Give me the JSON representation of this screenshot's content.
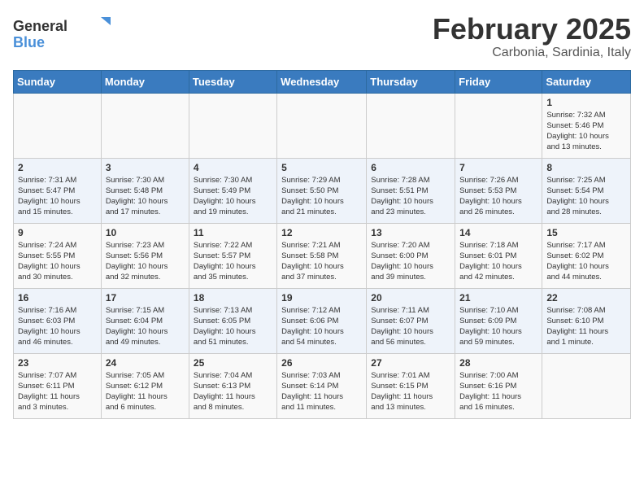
{
  "logo": {
    "general": "General",
    "blue": "Blue"
  },
  "title": "February 2025",
  "subtitle": "Carbonia, Sardinia, Italy",
  "headers": [
    "Sunday",
    "Monday",
    "Tuesday",
    "Wednesday",
    "Thursday",
    "Friday",
    "Saturday"
  ],
  "weeks": [
    [
      {
        "day": "",
        "info": ""
      },
      {
        "day": "",
        "info": ""
      },
      {
        "day": "",
        "info": ""
      },
      {
        "day": "",
        "info": ""
      },
      {
        "day": "",
        "info": ""
      },
      {
        "day": "",
        "info": ""
      },
      {
        "day": "1",
        "info": "Sunrise: 7:32 AM\nSunset: 5:46 PM\nDaylight: 10 hours\nand 13 minutes."
      }
    ],
    [
      {
        "day": "2",
        "info": "Sunrise: 7:31 AM\nSunset: 5:47 PM\nDaylight: 10 hours\nand 15 minutes."
      },
      {
        "day": "3",
        "info": "Sunrise: 7:30 AM\nSunset: 5:48 PM\nDaylight: 10 hours\nand 17 minutes."
      },
      {
        "day": "4",
        "info": "Sunrise: 7:30 AM\nSunset: 5:49 PM\nDaylight: 10 hours\nand 19 minutes."
      },
      {
        "day": "5",
        "info": "Sunrise: 7:29 AM\nSunset: 5:50 PM\nDaylight: 10 hours\nand 21 minutes."
      },
      {
        "day": "6",
        "info": "Sunrise: 7:28 AM\nSunset: 5:51 PM\nDaylight: 10 hours\nand 23 minutes."
      },
      {
        "day": "7",
        "info": "Sunrise: 7:26 AM\nSunset: 5:53 PM\nDaylight: 10 hours\nand 26 minutes."
      },
      {
        "day": "8",
        "info": "Sunrise: 7:25 AM\nSunset: 5:54 PM\nDaylight: 10 hours\nand 28 minutes."
      }
    ],
    [
      {
        "day": "9",
        "info": "Sunrise: 7:24 AM\nSunset: 5:55 PM\nDaylight: 10 hours\nand 30 minutes."
      },
      {
        "day": "10",
        "info": "Sunrise: 7:23 AM\nSunset: 5:56 PM\nDaylight: 10 hours\nand 32 minutes."
      },
      {
        "day": "11",
        "info": "Sunrise: 7:22 AM\nSunset: 5:57 PM\nDaylight: 10 hours\nand 35 minutes."
      },
      {
        "day": "12",
        "info": "Sunrise: 7:21 AM\nSunset: 5:58 PM\nDaylight: 10 hours\nand 37 minutes."
      },
      {
        "day": "13",
        "info": "Sunrise: 7:20 AM\nSunset: 6:00 PM\nDaylight: 10 hours\nand 39 minutes."
      },
      {
        "day": "14",
        "info": "Sunrise: 7:18 AM\nSunset: 6:01 PM\nDaylight: 10 hours\nand 42 minutes."
      },
      {
        "day": "15",
        "info": "Sunrise: 7:17 AM\nSunset: 6:02 PM\nDaylight: 10 hours\nand 44 minutes."
      }
    ],
    [
      {
        "day": "16",
        "info": "Sunrise: 7:16 AM\nSunset: 6:03 PM\nDaylight: 10 hours\nand 46 minutes."
      },
      {
        "day": "17",
        "info": "Sunrise: 7:15 AM\nSunset: 6:04 PM\nDaylight: 10 hours\nand 49 minutes."
      },
      {
        "day": "18",
        "info": "Sunrise: 7:13 AM\nSunset: 6:05 PM\nDaylight: 10 hours\nand 51 minutes."
      },
      {
        "day": "19",
        "info": "Sunrise: 7:12 AM\nSunset: 6:06 PM\nDaylight: 10 hours\nand 54 minutes."
      },
      {
        "day": "20",
        "info": "Sunrise: 7:11 AM\nSunset: 6:07 PM\nDaylight: 10 hours\nand 56 minutes."
      },
      {
        "day": "21",
        "info": "Sunrise: 7:10 AM\nSunset: 6:09 PM\nDaylight: 10 hours\nand 59 minutes."
      },
      {
        "day": "22",
        "info": "Sunrise: 7:08 AM\nSunset: 6:10 PM\nDaylight: 11 hours\nand 1 minute."
      }
    ],
    [
      {
        "day": "23",
        "info": "Sunrise: 7:07 AM\nSunset: 6:11 PM\nDaylight: 11 hours\nand 3 minutes."
      },
      {
        "day": "24",
        "info": "Sunrise: 7:05 AM\nSunset: 6:12 PM\nDaylight: 11 hours\nand 6 minutes."
      },
      {
        "day": "25",
        "info": "Sunrise: 7:04 AM\nSunset: 6:13 PM\nDaylight: 11 hours\nand 8 minutes."
      },
      {
        "day": "26",
        "info": "Sunrise: 7:03 AM\nSunset: 6:14 PM\nDaylight: 11 hours\nand 11 minutes."
      },
      {
        "day": "27",
        "info": "Sunrise: 7:01 AM\nSunset: 6:15 PM\nDaylight: 11 hours\nand 13 minutes."
      },
      {
        "day": "28",
        "info": "Sunrise: 7:00 AM\nSunset: 6:16 PM\nDaylight: 11 hours\nand 16 minutes."
      },
      {
        "day": "",
        "info": ""
      }
    ]
  ]
}
